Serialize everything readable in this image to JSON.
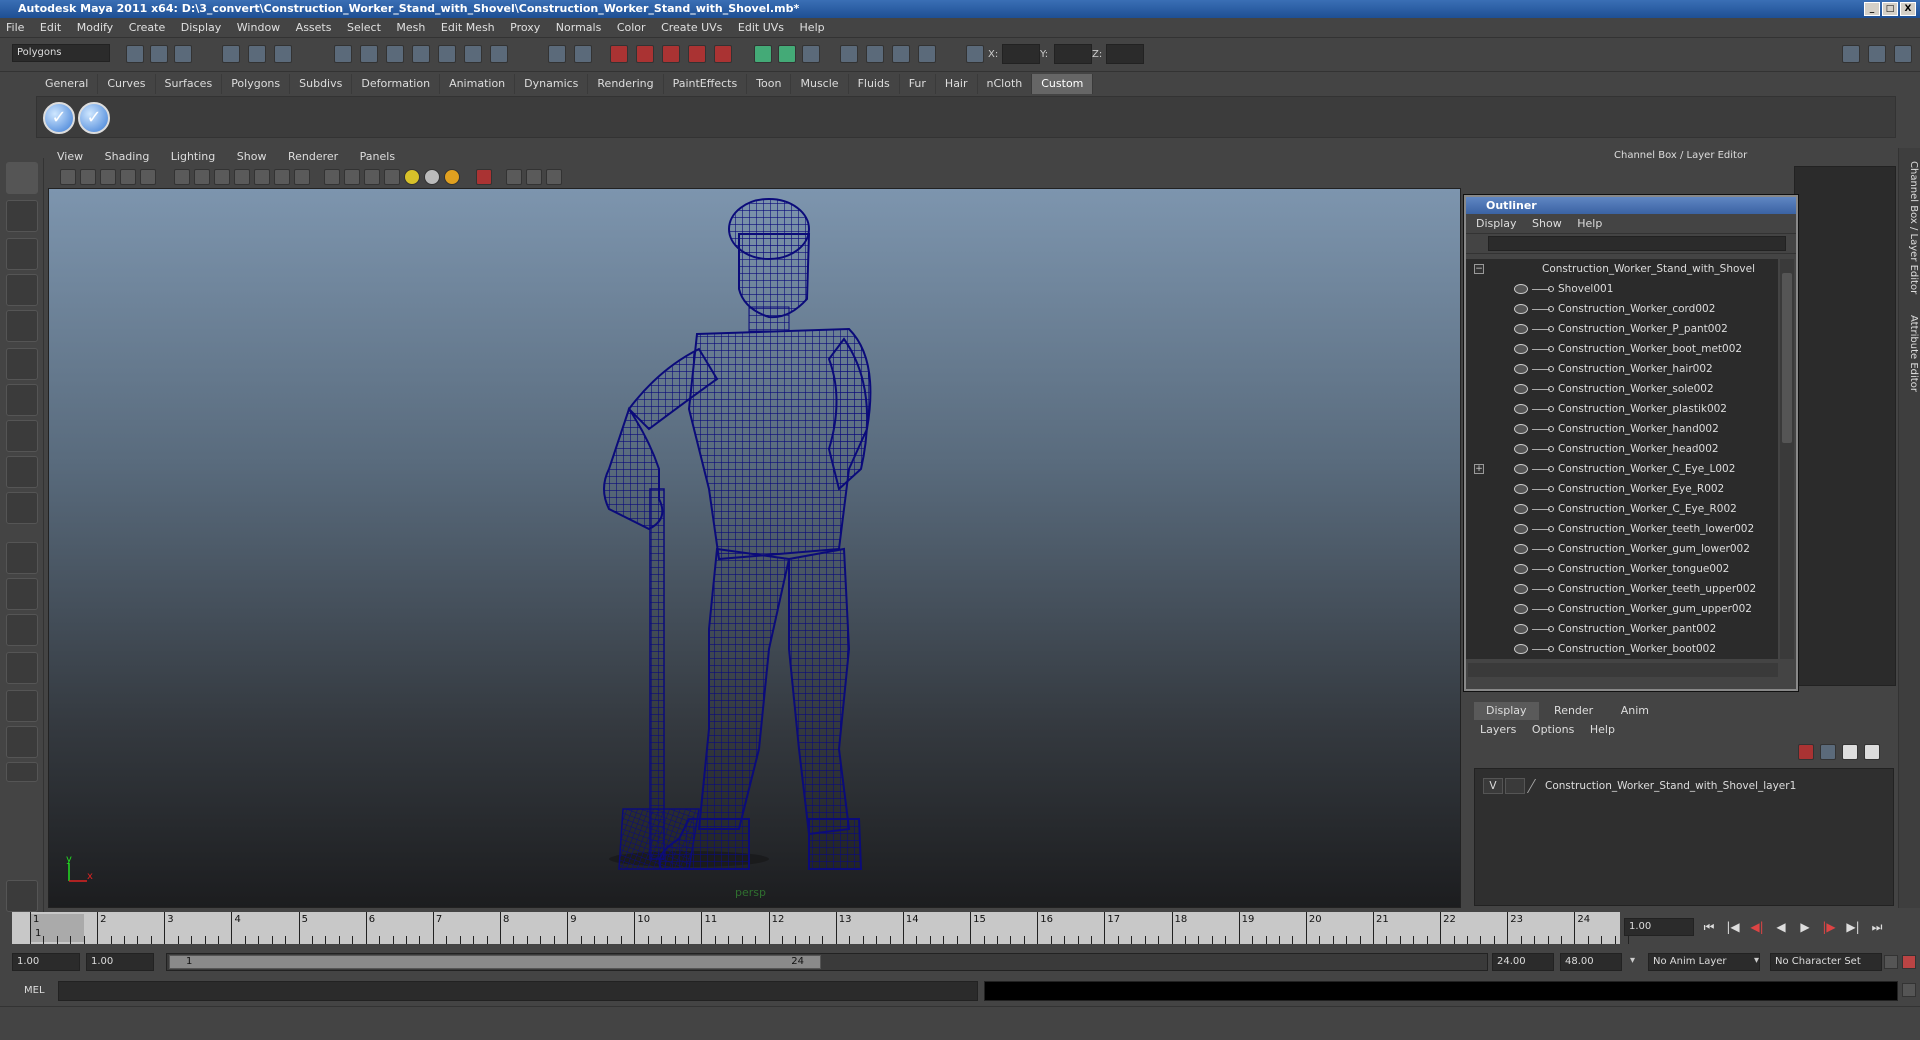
{
  "window": {
    "title": "Autodesk Maya 2011 x64: D:\\3_convert\\Construction_Worker_Stand_with_Shovel\\Construction_Worker_Stand_with_Shovel.mb*",
    "min": "_",
    "max": "□",
    "close": "X"
  },
  "menubar": [
    "File",
    "Edit",
    "Modify",
    "Create",
    "Display",
    "Window",
    "Assets",
    "Select",
    "Mesh",
    "Edit Mesh",
    "Proxy",
    "Normals",
    "Color",
    "Create UVs",
    "Edit UVs",
    "Help"
  ],
  "statusline": {
    "mode": "Polygons",
    "x_label": "X:",
    "y_label": "Y:",
    "z_label": "Z:"
  },
  "shelf": {
    "tabs": [
      "General",
      "Curves",
      "Surfaces",
      "Polygons",
      "Subdivs",
      "Deformation",
      "Animation",
      "Dynamics",
      "Rendering",
      "PaintEffects",
      "Toon",
      "Muscle",
      "Fluids",
      "Fur",
      "Hair",
      "nCloth",
      "Custom"
    ],
    "active_tab": "Custom"
  },
  "panel": {
    "menu": [
      "View",
      "Shading",
      "Lighting",
      "Show",
      "Renderer",
      "Panels"
    ],
    "camera": "persp"
  },
  "channelbox": {
    "title": "Channel Box / Layer Editor"
  },
  "outliner": {
    "title": "Outliner",
    "menu": [
      "Display",
      "Show",
      "Help"
    ],
    "root": "Construction_Worker_Stand_with_Shovel",
    "items": [
      "Shovel001",
      "Construction_Worker_cord002",
      "Construction_Worker_P_pant002",
      "Construction_Worker_boot_met002",
      "Construction_Worker_hair002",
      "Construction_Worker_sole002",
      "Construction_Worker_plastik002",
      "Construction_Worker_hand002",
      "Construction_Worker_head002",
      "Construction_Worker_C_Eye_L002",
      "Construction_Worker_Eye_R002",
      "Construction_Worker_C_Eye_R002",
      "Construction_Worker_teeth_lower002",
      "Construction_Worker_gum_lower002",
      "Construction_Worker_tongue002",
      "Construction_Worker_teeth_upper002",
      "Construction_Worker_gum_upper002",
      "Construction_Worker_pant002",
      "Construction_Worker_boot002"
    ]
  },
  "layer_editor": {
    "tabs": [
      "Display",
      "Render",
      "Anim"
    ],
    "active_tab": "Display",
    "menu": [
      "Layers",
      "Options",
      "Help"
    ],
    "layers": [
      {
        "visible": "V",
        "name": "Construction_Worker_Stand_with_Shovel_layer1"
      }
    ]
  },
  "side_tabs": [
    "Channel Box / Layer Editor",
    "Attribute Editor"
  ],
  "timeline": {
    "ticks": [
      "1",
      "2",
      "3",
      "4",
      "5",
      "6",
      "7",
      "8",
      "9",
      "10",
      "11",
      "12",
      "13",
      "14",
      "15",
      "16",
      "17",
      "18",
      "19",
      "20",
      "21",
      "22",
      "23",
      "24"
    ],
    "current_marker": "1",
    "current_frame": "1.00"
  },
  "range": {
    "start": "1.00",
    "inner_start": "1.00",
    "slider_start": "1",
    "slider_end": "24",
    "inner_end": "24.00",
    "end": "48.00",
    "anim_layer": "No Anim Layer",
    "char_set": "No Character Set"
  },
  "cmdline": {
    "label": "MEL"
  },
  "colors": {
    "wireframe": "#0b0b7a",
    "title_blue": "#1e4f94"
  }
}
